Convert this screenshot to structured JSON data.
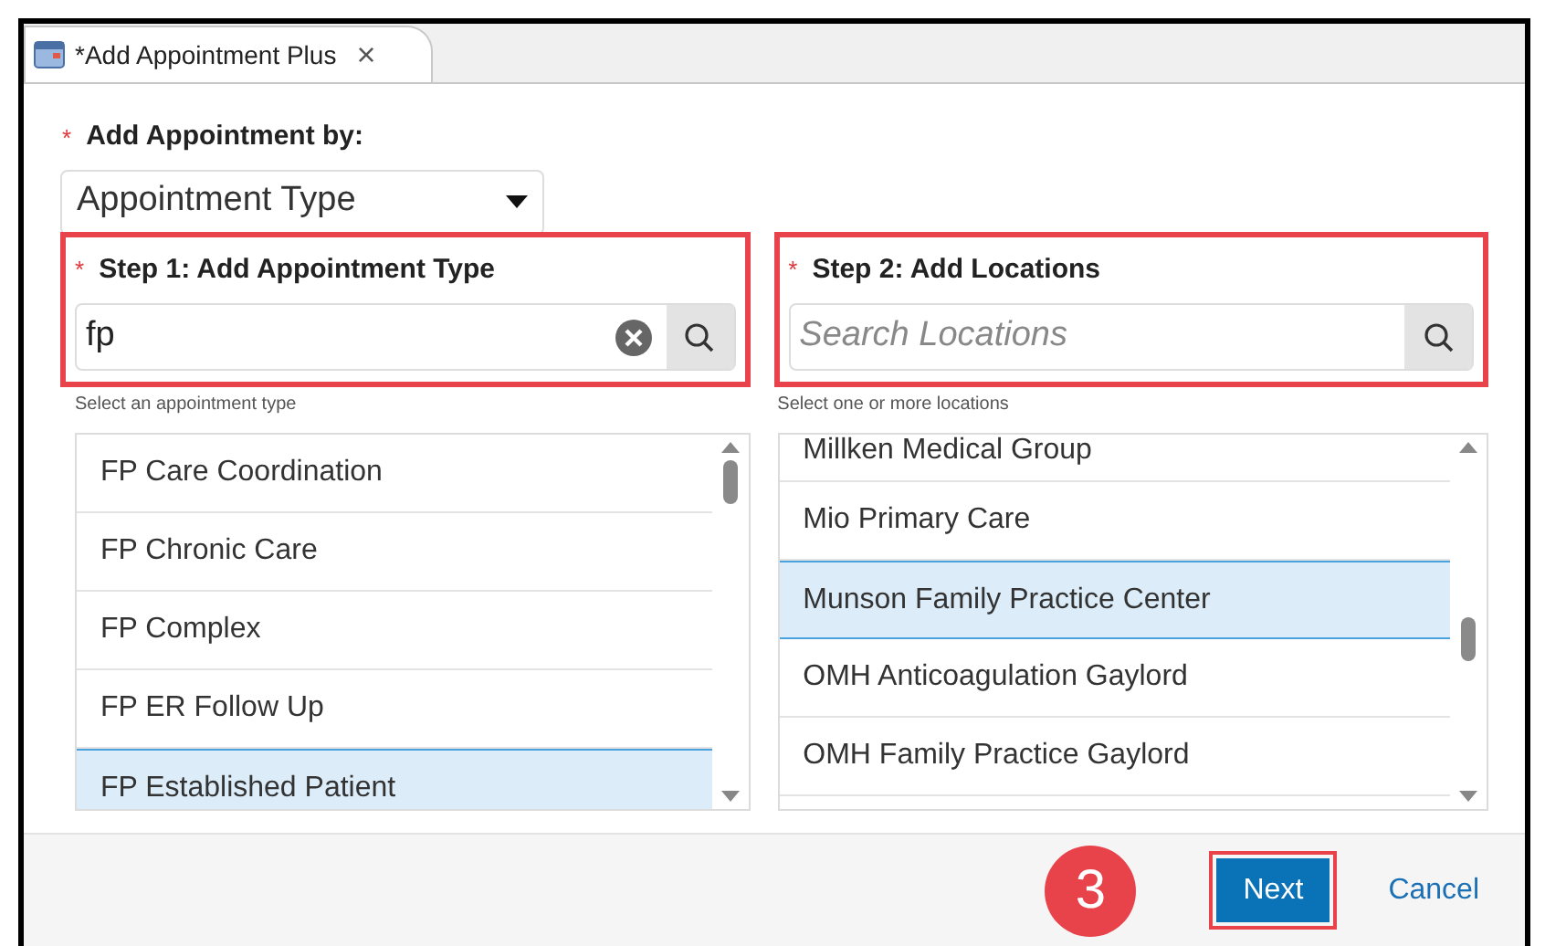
{
  "tab": {
    "title": "*Add Appointment Plus",
    "close": "×"
  },
  "add_by": {
    "label": "Add Appointment by:",
    "required_mark": "*",
    "value": "Appointment Type"
  },
  "step1": {
    "label": "Step 1: Add Appointment Type",
    "required_mark": "*",
    "value": "fp",
    "hint": "Select an appointment type",
    "items": [
      {
        "label": "FP Care Coordination",
        "selected": false
      },
      {
        "label": "FP Chronic Care",
        "selected": false
      },
      {
        "label": "FP Complex",
        "selected": false
      },
      {
        "label": "FP ER Follow Up",
        "selected": false
      },
      {
        "label": "FP Established Patient",
        "selected": true
      }
    ]
  },
  "step2": {
    "label": "Step 2: Add Locations",
    "required_mark": "*",
    "placeholder": "Search Locations",
    "hint": "Select one or more locations",
    "items": [
      {
        "label": "Millken Medical Group",
        "selected": false
      },
      {
        "label": "Mio Primary Care",
        "selected": false
      },
      {
        "label": "Munson Family Practice Center",
        "selected": true
      },
      {
        "label": "OMH Anticoagulation Gaylord",
        "selected": false
      },
      {
        "label": "OMH Family Practice Gaylord",
        "selected": false
      }
    ]
  },
  "footer": {
    "step_badge": "3",
    "next": "Next",
    "cancel": "Cancel"
  }
}
